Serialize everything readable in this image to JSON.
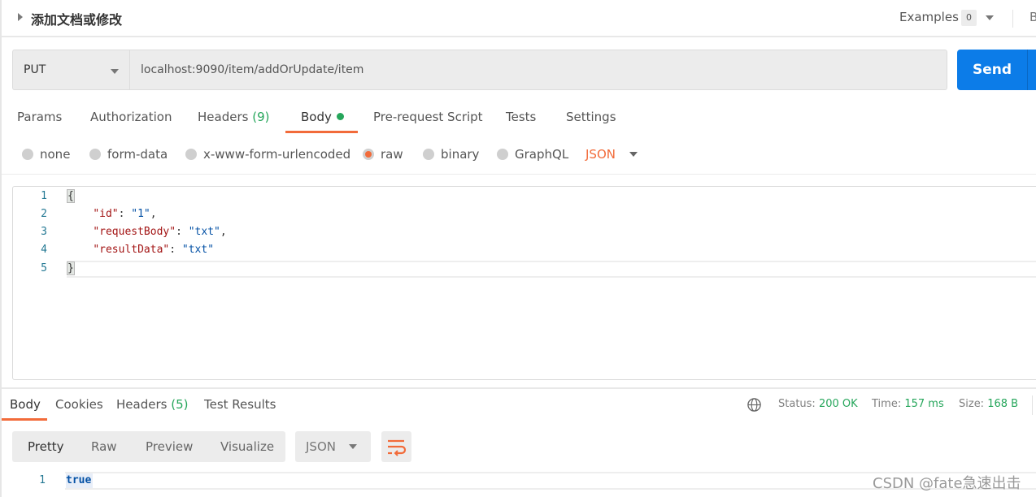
{
  "title": {
    "text": "添加文档或修改",
    "examples_label": "Examples",
    "examples_count": "0",
    "truncated_label": "B"
  },
  "request": {
    "method": "PUT",
    "url": "localhost:9090/item/addOrUpdate/item",
    "send_label": "Send"
  },
  "request_tabs": [
    {
      "label": "Params"
    },
    {
      "label": "Authorization"
    },
    {
      "label": "Headers",
      "count": "(9)"
    },
    {
      "label": "Body",
      "active": true,
      "indicator": "green-dot"
    },
    {
      "label": "Pre-request Script"
    },
    {
      "label": "Tests"
    },
    {
      "label": "Settings"
    }
  ],
  "body_types": [
    {
      "label": "none",
      "selected": false
    },
    {
      "label": "form-data",
      "selected": false
    },
    {
      "label": "x-www-form-urlencoded",
      "selected": false
    },
    {
      "label": "raw",
      "selected": true
    },
    {
      "label": "binary",
      "selected": false
    },
    {
      "label": "GraphQL",
      "selected": false
    }
  ],
  "body_format": "JSON",
  "editor": {
    "lines": [
      {
        "n": "1",
        "text": "{"
      },
      {
        "n": "2",
        "key": "\"id\"",
        "value": "\"1\"",
        "trail": ","
      },
      {
        "n": "3",
        "key": "\"requestBody\"",
        "value": "\"txt\"",
        "trail": ","
      },
      {
        "n": "4",
        "key": "\"resultData\"",
        "value": "\"txt\"",
        "trail": ""
      },
      {
        "n": "5",
        "text": "}"
      }
    ]
  },
  "response_tabs": [
    {
      "label": "Body",
      "active": true
    },
    {
      "label": "Cookies"
    },
    {
      "label": "Headers",
      "count": "(5)"
    },
    {
      "label": "Test Results"
    }
  ],
  "response_status": {
    "status_label": "Status:",
    "status_value": "200 OK",
    "time_label": "Time:",
    "time_value": "157 ms",
    "size_label": "Size:",
    "size_value": "168 B"
  },
  "response_view": {
    "options": [
      "Pretty",
      "Raw",
      "Preview",
      "Visualize"
    ],
    "active": "Pretty",
    "format": "JSON"
  },
  "response_body": {
    "lines": [
      {
        "n": "1",
        "text": "true"
      }
    ]
  },
  "colors": {
    "accent": "#f26b3a",
    "send": "#0c7ce8",
    "success": "#26a65b"
  },
  "watermark": "CSDN @fate急速出击"
}
